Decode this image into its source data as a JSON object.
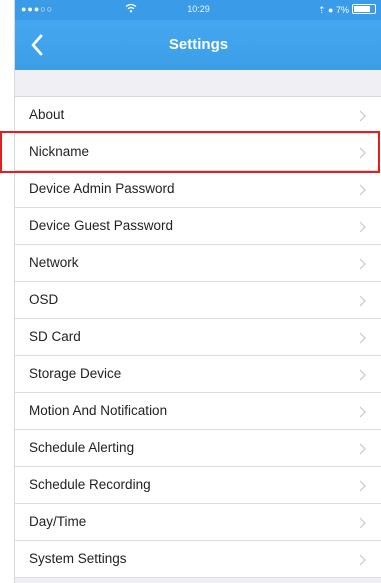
{
  "status_bar": {
    "signal": "●●●○○",
    "wifi": "wifi-icon",
    "time": "10:29",
    "right": "⇡ ● 7%"
  },
  "nav": {
    "title": "Settings",
    "back_icon": "chevron-left-icon"
  },
  "settings_items": [
    {
      "label": "About"
    },
    {
      "label": "Nickname"
    },
    {
      "label": "Device Admin Password"
    },
    {
      "label": "Device Guest Password"
    },
    {
      "label": "Network"
    },
    {
      "label": "OSD"
    },
    {
      "label": "SD Card"
    },
    {
      "label": "Storage Device"
    },
    {
      "label": "Motion And Notification"
    },
    {
      "label": "Schedule Alerting"
    },
    {
      "label": "Schedule Recording"
    },
    {
      "label": "Day/Time"
    },
    {
      "label": "System Settings"
    }
  ],
  "highlighted_item": "Nickname",
  "colors": {
    "nav_blue": "#3b9ee6",
    "highlight_red": "#e02020",
    "background": "#efeff4"
  }
}
